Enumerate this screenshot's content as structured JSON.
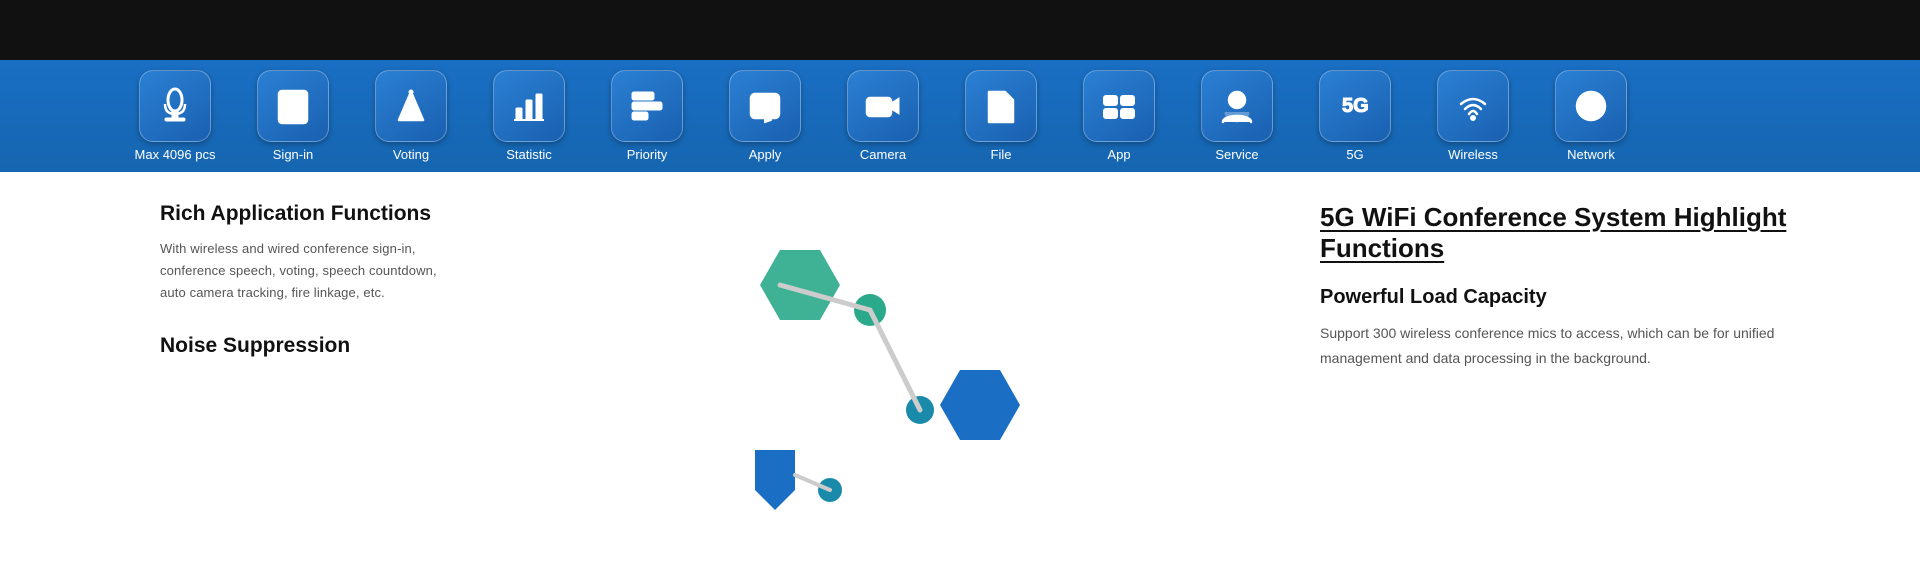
{
  "topBar": {
    "height": 60
  },
  "toolbar": {
    "items": [
      {
        "id": "max4096",
        "label": "Max 4096 pcs",
        "icon": "mic"
      },
      {
        "id": "signin",
        "label": "Sign-in",
        "icon": "signin"
      },
      {
        "id": "voting",
        "label": "Voting",
        "icon": "voting"
      },
      {
        "id": "statistic",
        "label": "Statistic",
        "icon": "statistic"
      },
      {
        "id": "priority",
        "label": "Priority",
        "icon": "priority"
      },
      {
        "id": "apply",
        "label": "Apply",
        "icon": "apply"
      },
      {
        "id": "camera",
        "label": "Camera",
        "icon": "camera"
      },
      {
        "id": "file",
        "label": "File",
        "icon": "file"
      },
      {
        "id": "app",
        "label": "App",
        "icon": "app"
      },
      {
        "id": "service",
        "label": "Service",
        "icon": "service"
      },
      {
        "id": "5g",
        "label": "5G",
        "icon": "5g"
      },
      {
        "id": "wireless",
        "label": "Wireless",
        "icon": "wireless"
      },
      {
        "id": "network",
        "label": "Network",
        "icon": "network"
      }
    ]
  },
  "left": {
    "title1": "Rich Application Functions",
    "body1": "With wireless and wired conference sign-in, conference speech, voting, speech countdown, auto camera tracking, fire linkage, etc.",
    "title2": "Noise Suppression"
  },
  "right": {
    "mainTitle": "5G WiFi Conference System  Highlight Functions",
    "subtitle": "Powerful Load Capacity",
    "body": "Support 300 wireless conference mics to access, which can be  for unified management and data processing in the background."
  }
}
